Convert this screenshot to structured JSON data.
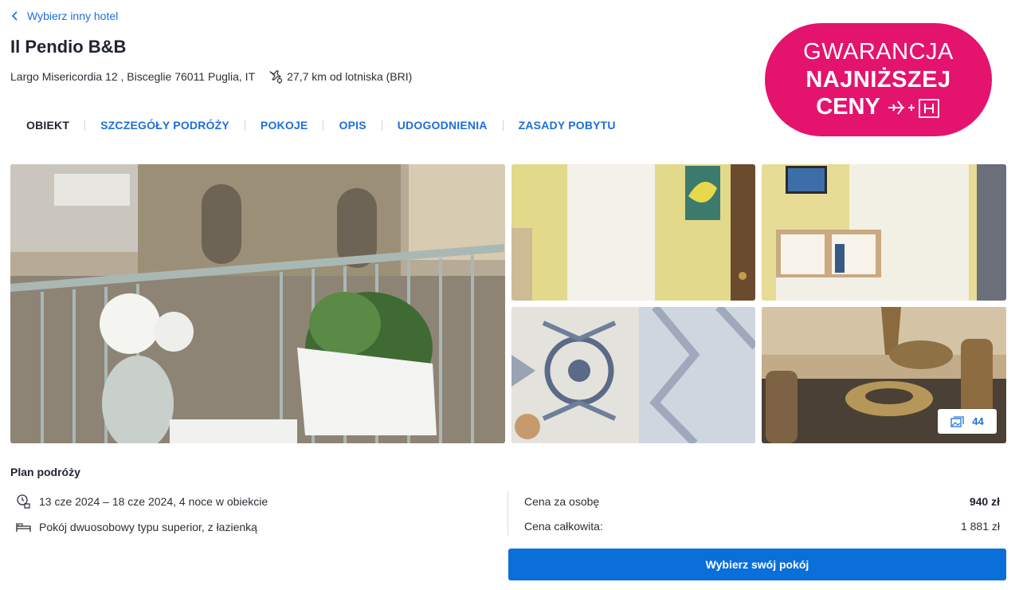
{
  "nav": {
    "back_label": "Wybierz inny hotel"
  },
  "hotel": {
    "name": "Il Pendio B&B",
    "address": "Largo Misericordia 12 , Bisceglie 76011 Puglia, IT",
    "airport_distance": "27,7 km od lotniska (BRI)"
  },
  "guarantee": {
    "line1": "GWARANCJA",
    "line2": "NAJNIŻSZEJ",
    "line3": "CENY",
    "color": "#e4136e"
  },
  "tabs": [
    {
      "label": "OBIEKT",
      "active": true
    },
    {
      "label": "SZCZEGÓŁY PODRÓŻY"
    },
    {
      "label": "POKOJE"
    },
    {
      "label": "OPIS"
    },
    {
      "label": "UDOGODNIENIA"
    },
    {
      "label": "ZASADY POBYTU"
    }
  ],
  "gallery": {
    "photo_count": "44",
    "photos": [
      "balcony-with-flowers",
      "hallway-door",
      "room-shelf",
      "decorative-tiles",
      "copper-pots"
    ]
  },
  "plan": {
    "title": "Plan podróży",
    "dates": "13 cze 2024 – 18 cze 2024, 4 noce w obiekcie",
    "room": "Pokój dwuosobowy typu superior, z łazienką"
  },
  "pricing": {
    "per_person_label": "Cena za osobę",
    "per_person_value": "940 zł",
    "total_label": "Cena całkowita:",
    "total_value": "1 881 zł"
  },
  "cta": {
    "label": "Wybierz swój pokój",
    "color": "#0b6fd9"
  },
  "colors": {
    "link": "#1d6fd8",
    "text": "#1f2430"
  }
}
